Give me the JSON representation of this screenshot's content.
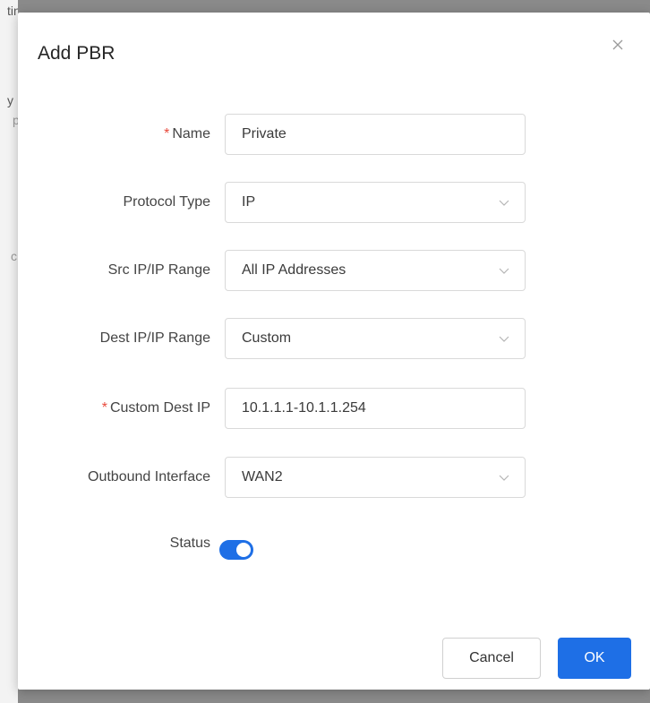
{
  "background": {
    "fragments": [
      "ting",
      "y",
      "p",
      "c"
    ]
  },
  "dialog": {
    "title": "Add PBR",
    "fields": [
      {
        "label": "Name",
        "required": true,
        "value": "Private",
        "type": "text"
      },
      {
        "label": "Protocol Type",
        "required": false,
        "value": "IP",
        "type": "select"
      },
      {
        "label": "Src IP/IP Range",
        "required": false,
        "value": "All IP Addresses",
        "type": "select"
      },
      {
        "label": "Dest IP/IP Range",
        "required": false,
        "value": "Custom",
        "type": "select"
      },
      {
        "label": "Custom Dest IP",
        "required": true,
        "value": "10.1.1.1-10.1.1.254",
        "type": "text"
      },
      {
        "label": "Outbound Interface",
        "required": false,
        "value": "WAN2",
        "type": "select"
      }
    ],
    "status": {
      "label": "Status",
      "enabled": true
    },
    "buttons": {
      "cancel": "Cancel",
      "ok": "OK"
    },
    "required_marker": "*"
  },
  "colors": {
    "primary": "#1e6fe6",
    "required": "#e84a3c"
  },
  "icons": {
    "close": "close-icon",
    "dropdown": "chevron-down-icon"
  }
}
